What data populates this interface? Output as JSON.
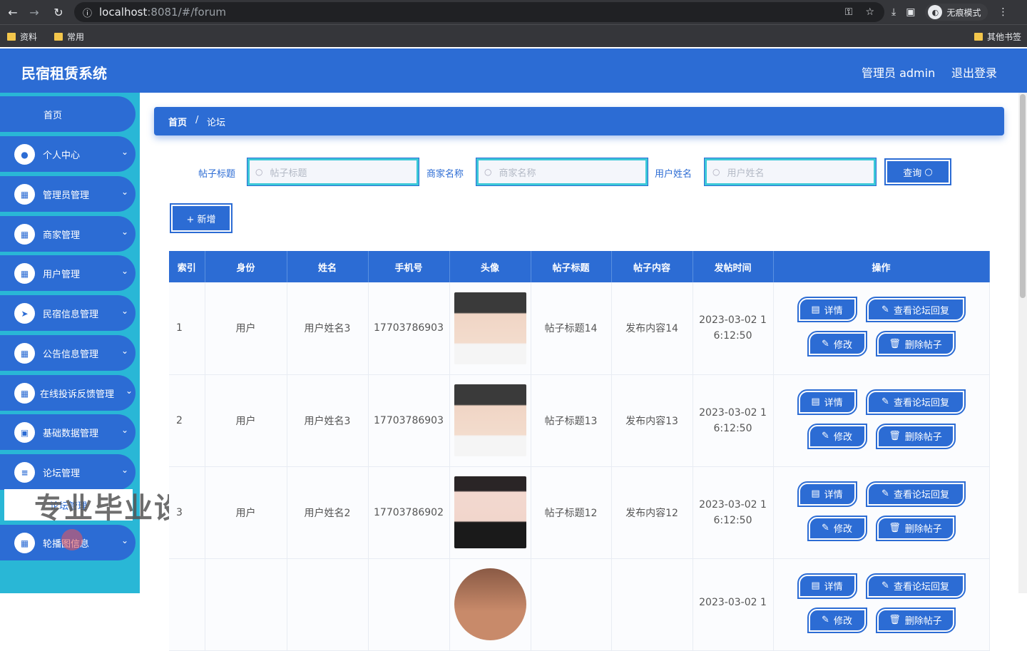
{
  "browser": {
    "url_host": "localhost",
    "url_rest": ":8081/#/forum",
    "incognito_label": "无痕模式",
    "bookmarks": [
      "资料",
      "常用"
    ],
    "other_bookmarks": "其他书签"
  },
  "header": {
    "title": "民宿租赁系统",
    "user": "管理员 admin",
    "logout": "退出登录"
  },
  "sidebar": {
    "items": [
      {
        "label": "首页",
        "icon": "home"
      },
      {
        "label": "个人中心",
        "icon": "person-icon"
      },
      {
        "label": "管理员管理",
        "icon": "grid-icon"
      },
      {
        "label": "商家管理",
        "icon": "grid-icon"
      },
      {
        "label": "用户管理",
        "icon": "grid-icon"
      },
      {
        "label": "民宿信息管理",
        "icon": "send-icon"
      },
      {
        "label": "公告信息管理",
        "icon": "grid-icon"
      },
      {
        "label": "在线投诉反馈管理",
        "icon": "grid-icon"
      },
      {
        "label": "基础数据管理",
        "icon": "clipboard-icon"
      },
      {
        "label": "论坛管理",
        "icon": "list-icon"
      },
      {
        "label": "轮播图信息",
        "icon": "grid-icon"
      }
    ],
    "sub_item": "论坛管理",
    "watermark": "专业毕业设计代做"
  },
  "breadcrumb": {
    "home": "首页",
    "sep": "/",
    "current": "论坛"
  },
  "filters": {
    "title_label": "帖子标题",
    "title_placeholder": "帖子标题",
    "merchant_label": "商家名称",
    "merchant_placeholder": "商家名称",
    "user_label": "用户姓名",
    "user_placeholder": "用户姓名",
    "search_btn": "查询",
    "add_btn": "+ 新增"
  },
  "table": {
    "headers": [
      "索引",
      "身份",
      "姓名",
      "手机号",
      "头像",
      "帖子标题",
      "帖子内容",
      "发帖时间",
      "操作"
    ],
    "rows": [
      {
        "index": "1",
        "role": "用户",
        "name": "用户姓名3",
        "phone": "17703786903",
        "title": "帖子标题14",
        "content": "发布内容14",
        "time1": "2023-03-02 1",
        "time2": "6:12:50"
      },
      {
        "index": "2",
        "role": "用户",
        "name": "用户姓名3",
        "phone": "17703786903",
        "title": "帖子标题13",
        "content": "发布内容13",
        "time1": "2023-03-02 1",
        "time2": "6:12:50"
      },
      {
        "index": "3",
        "role": "用户",
        "name": "用户姓名2",
        "phone": "17703786902",
        "title": "帖子标题12",
        "content": "发布内容12",
        "time1": "2023-03-02 1",
        "time2": "6:12:50"
      },
      {
        "index": "",
        "role": "",
        "name": "",
        "phone": "",
        "title": "",
        "content": "",
        "time1": "2023-03-02 1",
        "time2": ""
      }
    ],
    "ops": {
      "detail": "详情",
      "view_reply": "查看论坛回复",
      "edit": "修改",
      "delete": "删除帖子"
    }
  }
}
